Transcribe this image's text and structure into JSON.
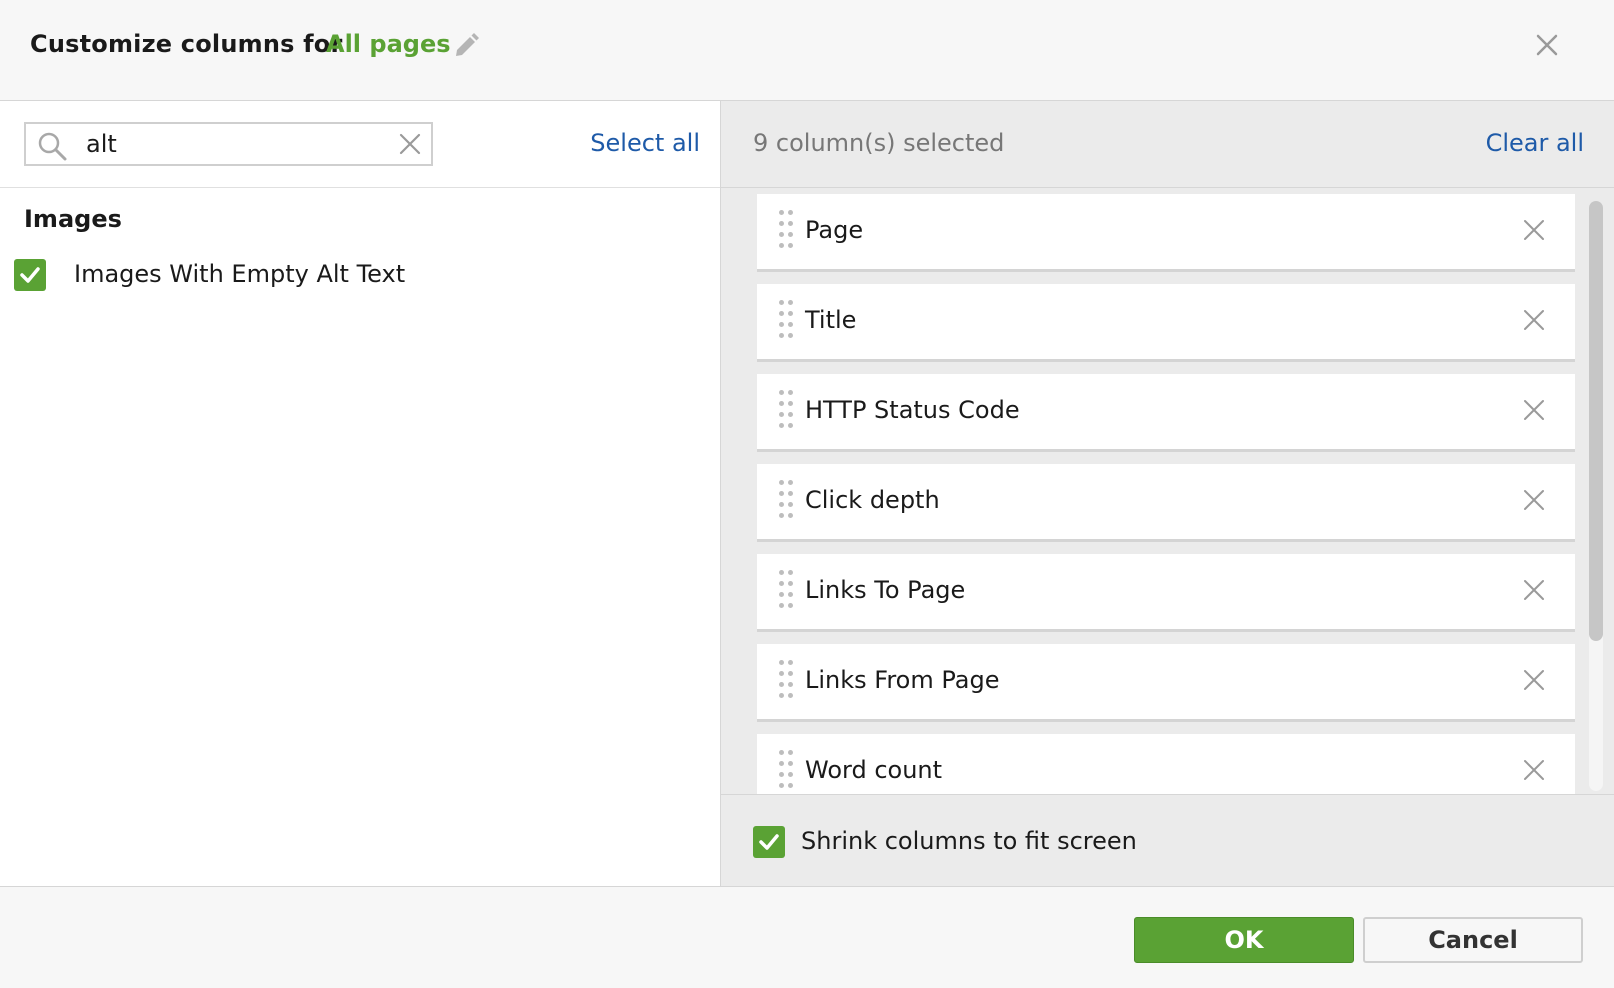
{
  "header": {
    "title": "Customize columns for",
    "title_link": "All pages",
    "edit_icon": "pencil-icon",
    "close_icon": "close-icon"
  },
  "left_panel": {
    "search": {
      "value": "alt",
      "placeholder": ""
    },
    "select_all_label": "Select all",
    "group_heading": "Images",
    "options": [
      {
        "label": "Images With Empty Alt Text",
        "checked": true
      }
    ]
  },
  "right_panel": {
    "selected_count_label": "9 column(s) selected",
    "clear_all_label": "Clear all",
    "columns": [
      "Page",
      "Title",
      "HTTP Status Code",
      "Click depth",
      "Links To Page",
      "Links From Page",
      "Word count"
    ],
    "shrink_label": "Shrink columns to fit screen",
    "shrink_checked": true
  },
  "footer": {
    "ok_label": "OK",
    "cancel_label": "Cancel"
  },
  "colors": {
    "accent_green": "#5aa234",
    "link_blue": "#1e5aa8"
  }
}
